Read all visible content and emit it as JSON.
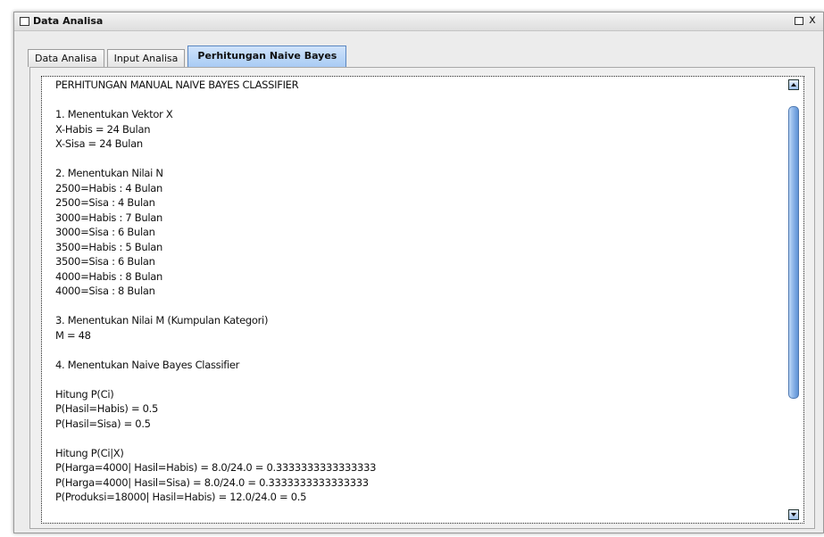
{
  "window": {
    "title": "Data Analisa",
    "maximize_icon": "maximize-icon",
    "close_label": "x"
  },
  "tabs": [
    {
      "label": "Data Analisa"
    },
    {
      "label": "Input Analisa"
    },
    {
      "label": "Perhitungan Naive Bayes",
      "active": true
    }
  ],
  "content": {
    "text": "PERHITUNGAN MANUAL NAIVE BAYES CLASSIFIER\n\n1. Menentukan Vektor X\nX-Habis = 24 Bulan\nX-Sisa = 24 Bulan\n\n2. Menentukan Nilai N\n2500=Habis : 4 Bulan\n2500=Sisa : 4 Bulan\n3000=Habis : 7 Bulan\n3000=Sisa : 6 Bulan\n3500=Habis : 5 Bulan\n3500=Sisa : 6 Bulan\n4000=Habis : 8 Bulan\n4000=Sisa : 8 Bulan\n\n3. Menentukan Nilai M (Kumpulan Kategori)\nM = 48\n\n4. Menentukan Naive Bayes Classifier\n\nHitung P(Ci)\nP(Hasil=Habis) = 0.5\nP(Hasil=Sisa) = 0.5\n\nHitung P(Ci|X)\nP(Harga=4000| Hasil=Habis) = 8.0/24.0 = 0.3333333333333333\nP(Harga=4000| Hasil=Sisa) = 8.0/24.0 = 0.3333333333333333\nP(Produksi=18000| Hasil=Habis) = 12.0/24.0 = 0.5"
  },
  "colors": {
    "active_tab": "#a9cbf4",
    "scroll_thumb": "#7fabe4"
  }
}
